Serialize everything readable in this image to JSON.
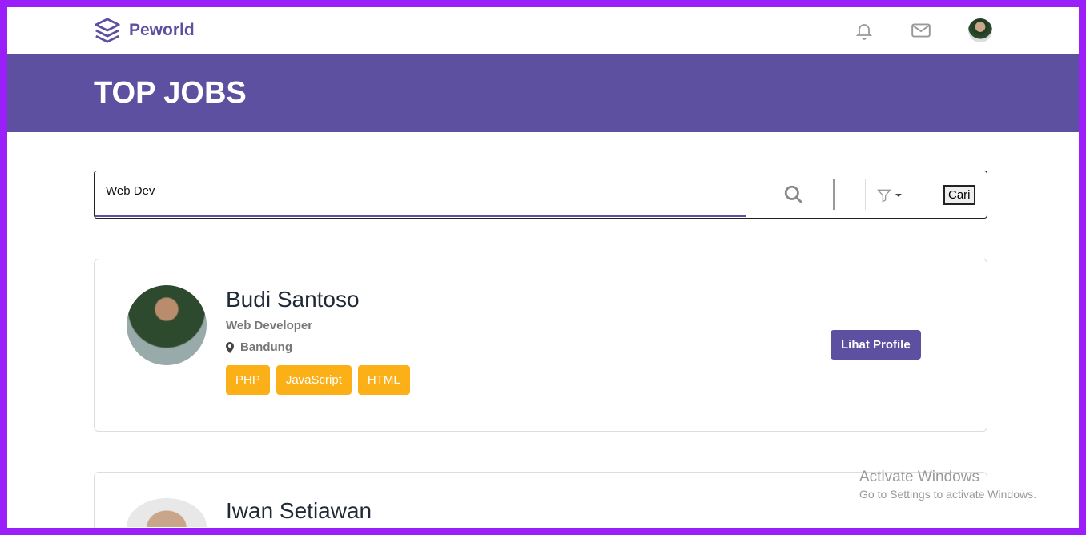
{
  "brand": "Peworld",
  "hero_title": "TOP JOBS",
  "search": {
    "value": "Web Dev",
    "button": "Cari"
  },
  "candidates": [
    {
      "name": "Budi Santoso",
      "role": "Web Developer",
      "location": "Bandung",
      "skills": [
        "PHP",
        "JavaScript",
        "HTML"
      ],
      "action": "Lihat Profile"
    },
    {
      "name": "Iwan Setiawan"
    }
  ],
  "watermark": {
    "line1": "Activate Windows",
    "line2": "Go to Settings to activate Windows."
  }
}
